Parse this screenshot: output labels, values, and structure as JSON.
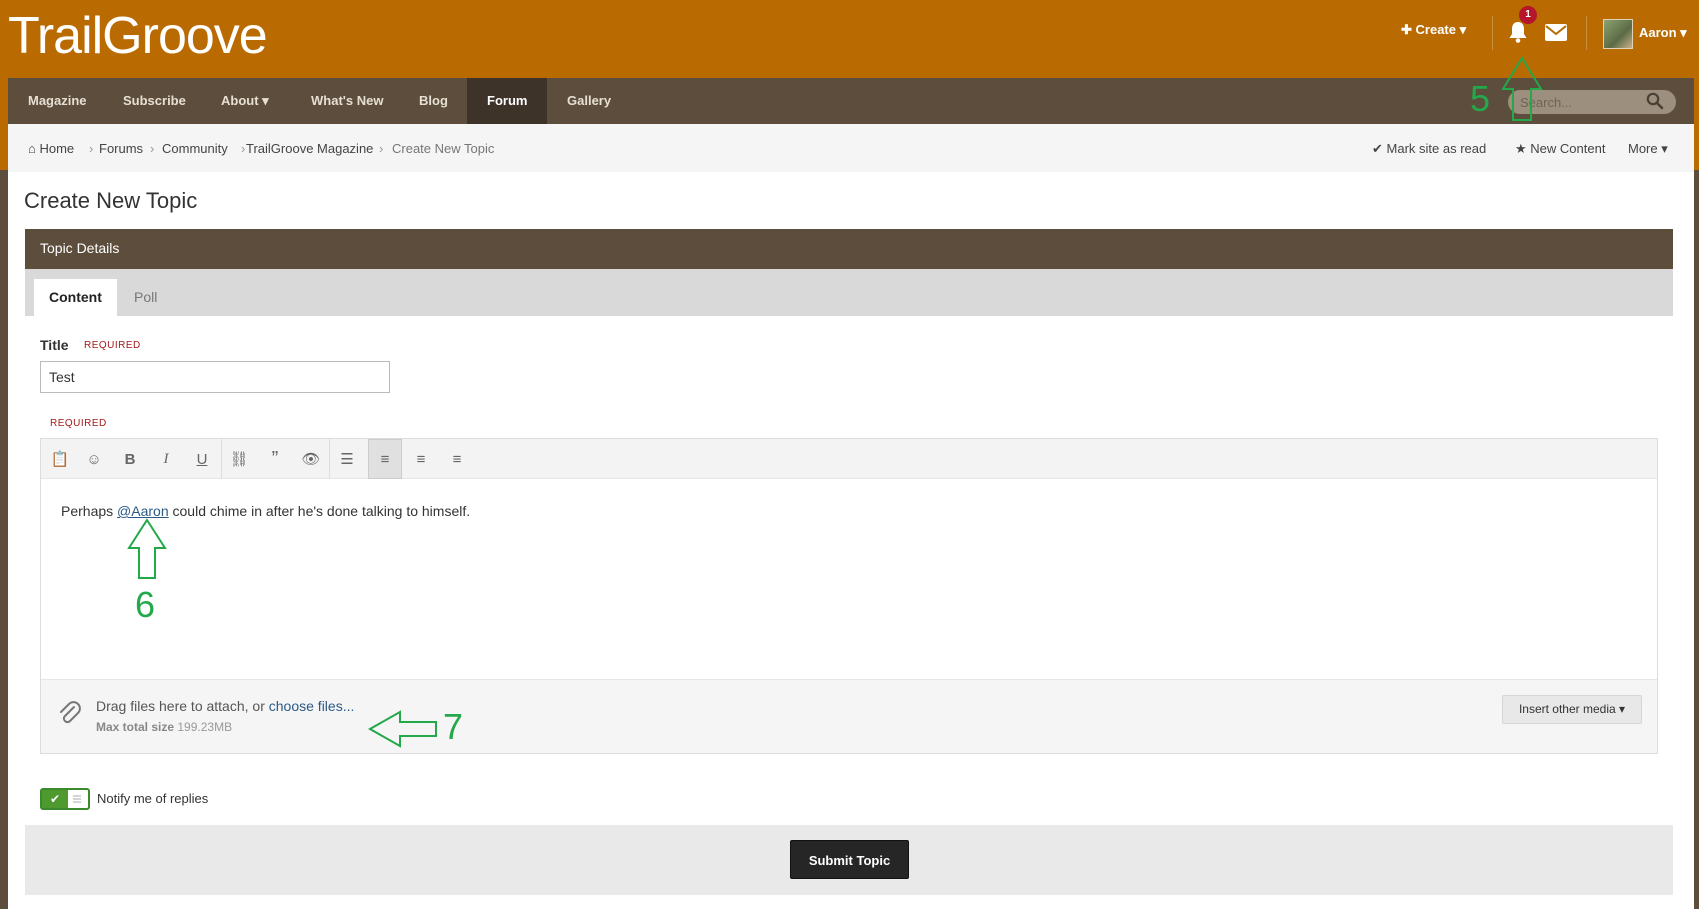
{
  "header": {
    "logo": "TrailGroove",
    "create_label": "Create",
    "notification_count": "1",
    "user_name": "Aaron"
  },
  "nav": {
    "items": [
      "Magazine",
      "Subscribe",
      "About",
      "What's New",
      "Blog",
      "Forum",
      "Gallery"
    ],
    "active": "Forum",
    "search_placeholder": "Search..."
  },
  "breadcrumb": {
    "items": [
      "Home",
      "Forums",
      "Community",
      "TrailGroove Magazine",
      "Create New Topic"
    ],
    "actions": [
      "Mark site as read",
      "New Content",
      "More"
    ]
  },
  "page": {
    "title": "Create New Topic",
    "panel_title": "Topic Details",
    "tabs": [
      "Content",
      "Poll"
    ],
    "active_tab": "Content"
  },
  "form": {
    "title_label": "Title",
    "required": "REQUIRED",
    "title_value": "Test",
    "editor_prefix": "Perhaps ",
    "editor_mention": "@Aaron",
    "editor_suffix": " could chime in after he's done talking to himself.",
    "attach_text": "Drag files here to attach, or ",
    "attach_link": "choose files...",
    "attach_size_label": "Max total size",
    "attach_size_value": "199.23MB",
    "insert_media": "Insert other media",
    "notify_label": "Notify me of replies",
    "submit_label": "Submit Topic"
  },
  "annotations": {
    "five": "5",
    "six": "6",
    "seven": "7",
    "color": "#23a84a"
  },
  "colors": {
    "header": "#b96b02",
    "nav": "#5c4d3c",
    "nav_active": "#3d3329",
    "badge": "#b5162b",
    "link": "#2b5a85",
    "toggle": "#4f9a2e"
  }
}
